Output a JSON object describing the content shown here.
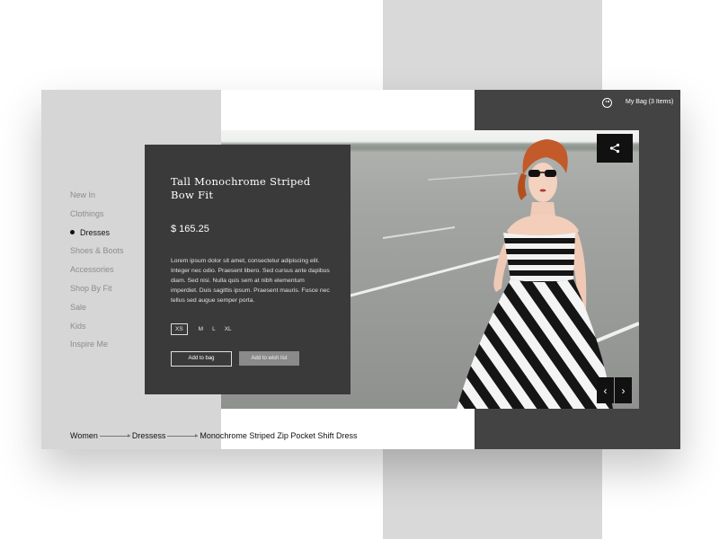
{
  "header": {
    "account_icon": "smiley-icon",
    "bag_label": "My Bag (3 Items)"
  },
  "sidebar": {
    "items": [
      {
        "label": "New In"
      },
      {
        "label": "Clothings"
      },
      {
        "label": "Dresses",
        "active": true
      },
      {
        "label": "Shoes & Boots"
      },
      {
        "label": "Accessories"
      },
      {
        "label": "Shop By Fit"
      },
      {
        "label": "Sale"
      },
      {
        "label": "Kids"
      },
      {
        "label": "Inspire Me"
      }
    ]
  },
  "product": {
    "title": "Tall Monochrome Striped Bow Fit",
    "price": "$ 165.25",
    "description": "Lorem ipsum dolor sit amet, consectetur adipiscing elit. Integer nec odio. Praesent libero. Sed cursus ante dapibus diam. Sed nisi. Nulla quis sem at nibh elementum imperdiet. Duis sagittis ipsum. Praesent mauris. Fusce nec tellus sed augue semper porta.",
    "sizes": [
      "XS",
      "M",
      "L",
      "XL"
    ],
    "selected_size": "XS",
    "add_to_bag_label": "Add to bag",
    "add_to_wishlist_label": "Add to wish list"
  },
  "gallery": {
    "share_icon": "share-icon",
    "prev_icon": "chevron-left-icon",
    "next_icon": "chevron-right-icon",
    "prev_glyph": "‹",
    "next_glyph": "›"
  },
  "breadcrumb": {
    "items": [
      "Women",
      "Dressess",
      "Monochrome Striped Zip Pocket Shift Dress"
    ]
  },
  "colors": {
    "page_bg": "#ffffff",
    "backdrop_strip": "#d9d9d9",
    "sidebar_bg": "#d6d6d6",
    "right_panel_bg": "#434343",
    "product_panel_bg": "#3a3a3a",
    "button_dark": "#111111",
    "wishlist_button_bg": "#8a8a8a"
  }
}
